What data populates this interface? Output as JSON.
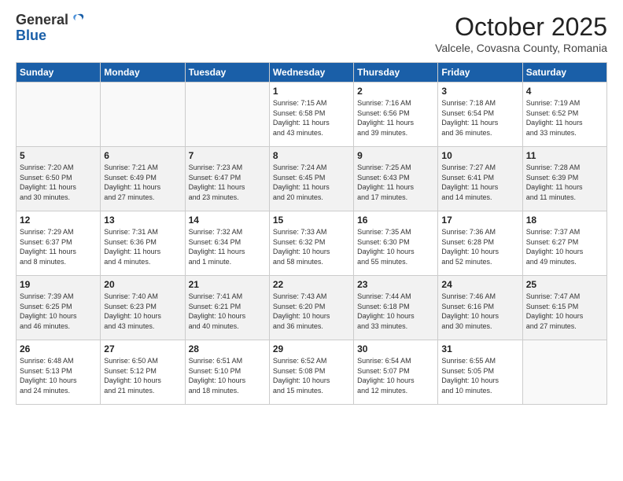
{
  "header": {
    "logo_general": "General",
    "logo_blue": "Blue",
    "month_title": "October 2025",
    "location": "Valcele, Covasna County, Romania"
  },
  "days_of_week": [
    "Sunday",
    "Monday",
    "Tuesday",
    "Wednesday",
    "Thursday",
    "Friday",
    "Saturday"
  ],
  "weeks": [
    [
      {
        "day": "",
        "info": ""
      },
      {
        "day": "",
        "info": ""
      },
      {
        "day": "",
        "info": ""
      },
      {
        "day": "1",
        "info": "Sunrise: 7:15 AM\nSunset: 6:58 PM\nDaylight: 11 hours\nand 43 minutes."
      },
      {
        "day": "2",
        "info": "Sunrise: 7:16 AM\nSunset: 6:56 PM\nDaylight: 11 hours\nand 39 minutes."
      },
      {
        "day": "3",
        "info": "Sunrise: 7:18 AM\nSunset: 6:54 PM\nDaylight: 11 hours\nand 36 minutes."
      },
      {
        "day": "4",
        "info": "Sunrise: 7:19 AM\nSunset: 6:52 PM\nDaylight: 11 hours\nand 33 minutes."
      }
    ],
    [
      {
        "day": "5",
        "info": "Sunrise: 7:20 AM\nSunset: 6:50 PM\nDaylight: 11 hours\nand 30 minutes."
      },
      {
        "day": "6",
        "info": "Sunrise: 7:21 AM\nSunset: 6:49 PM\nDaylight: 11 hours\nand 27 minutes."
      },
      {
        "day": "7",
        "info": "Sunrise: 7:23 AM\nSunset: 6:47 PM\nDaylight: 11 hours\nand 23 minutes."
      },
      {
        "day": "8",
        "info": "Sunrise: 7:24 AM\nSunset: 6:45 PM\nDaylight: 11 hours\nand 20 minutes."
      },
      {
        "day": "9",
        "info": "Sunrise: 7:25 AM\nSunset: 6:43 PM\nDaylight: 11 hours\nand 17 minutes."
      },
      {
        "day": "10",
        "info": "Sunrise: 7:27 AM\nSunset: 6:41 PM\nDaylight: 11 hours\nand 14 minutes."
      },
      {
        "day": "11",
        "info": "Sunrise: 7:28 AM\nSunset: 6:39 PM\nDaylight: 11 hours\nand 11 minutes."
      }
    ],
    [
      {
        "day": "12",
        "info": "Sunrise: 7:29 AM\nSunset: 6:37 PM\nDaylight: 11 hours\nand 8 minutes."
      },
      {
        "day": "13",
        "info": "Sunrise: 7:31 AM\nSunset: 6:36 PM\nDaylight: 11 hours\nand 4 minutes."
      },
      {
        "day": "14",
        "info": "Sunrise: 7:32 AM\nSunset: 6:34 PM\nDaylight: 11 hours\nand 1 minute."
      },
      {
        "day": "15",
        "info": "Sunrise: 7:33 AM\nSunset: 6:32 PM\nDaylight: 10 hours\nand 58 minutes."
      },
      {
        "day": "16",
        "info": "Sunrise: 7:35 AM\nSunset: 6:30 PM\nDaylight: 10 hours\nand 55 minutes."
      },
      {
        "day": "17",
        "info": "Sunrise: 7:36 AM\nSunset: 6:28 PM\nDaylight: 10 hours\nand 52 minutes."
      },
      {
        "day": "18",
        "info": "Sunrise: 7:37 AM\nSunset: 6:27 PM\nDaylight: 10 hours\nand 49 minutes."
      }
    ],
    [
      {
        "day": "19",
        "info": "Sunrise: 7:39 AM\nSunset: 6:25 PM\nDaylight: 10 hours\nand 46 minutes."
      },
      {
        "day": "20",
        "info": "Sunrise: 7:40 AM\nSunset: 6:23 PM\nDaylight: 10 hours\nand 43 minutes."
      },
      {
        "day": "21",
        "info": "Sunrise: 7:41 AM\nSunset: 6:21 PM\nDaylight: 10 hours\nand 40 minutes."
      },
      {
        "day": "22",
        "info": "Sunrise: 7:43 AM\nSunset: 6:20 PM\nDaylight: 10 hours\nand 36 minutes."
      },
      {
        "day": "23",
        "info": "Sunrise: 7:44 AM\nSunset: 6:18 PM\nDaylight: 10 hours\nand 33 minutes."
      },
      {
        "day": "24",
        "info": "Sunrise: 7:46 AM\nSunset: 6:16 PM\nDaylight: 10 hours\nand 30 minutes."
      },
      {
        "day": "25",
        "info": "Sunrise: 7:47 AM\nSunset: 6:15 PM\nDaylight: 10 hours\nand 27 minutes."
      }
    ],
    [
      {
        "day": "26",
        "info": "Sunrise: 6:48 AM\nSunset: 5:13 PM\nDaylight: 10 hours\nand 24 minutes."
      },
      {
        "day": "27",
        "info": "Sunrise: 6:50 AM\nSunset: 5:12 PM\nDaylight: 10 hours\nand 21 minutes."
      },
      {
        "day": "28",
        "info": "Sunrise: 6:51 AM\nSunset: 5:10 PM\nDaylight: 10 hours\nand 18 minutes."
      },
      {
        "day": "29",
        "info": "Sunrise: 6:52 AM\nSunset: 5:08 PM\nDaylight: 10 hours\nand 15 minutes."
      },
      {
        "day": "30",
        "info": "Sunrise: 6:54 AM\nSunset: 5:07 PM\nDaylight: 10 hours\nand 12 minutes."
      },
      {
        "day": "31",
        "info": "Sunrise: 6:55 AM\nSunset: 5:05 PM\nDaylight: 10 hours\nand 10 minutes."
      },
      {
        "day": "",
        "info": ""
      }
    ]
  ]
}
